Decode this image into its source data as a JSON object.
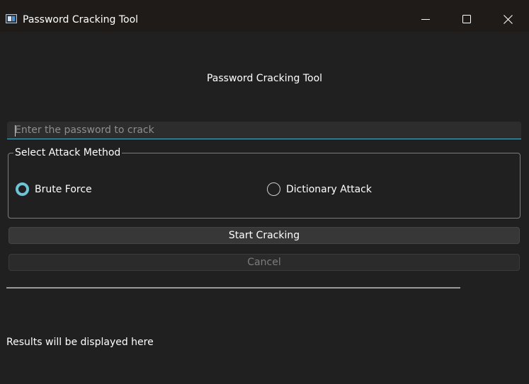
{
  "window": {
    "title": "Password Cracking Tool",
    "icon": "app-window-icon",
    "controls": {
      "minimize_icon": "minimize-icon",
      "maximize_icon": "maximize-icon",
      "close_icon": "close-icon"
    }
  },
  "main": {
    "header": "Password Cracking Tool",
    "password_input": {
      "value": "",
      "placeholder": "Enter the password to crack"
    },
    "attack_method": {
      "title": "Select Attack Method",
      "options": [
        {
          "label": "Brute Force",
          "checked": true
        },
        {
          "label": "Dictionary Attack",
          "checked": false
        }
      ]
    },
    "buttons": {
      "start": "Start Cracking",
      "cancel": "Cancel"
    },
    "progress": {
      "value": 0
    },
    "results": "Results will be displayed here"
  },
  "colors": {
    "background": "#202020",
    "accent": "#6ec3d6",
    "disabled_text": "#7d7d7d"
  }
}
